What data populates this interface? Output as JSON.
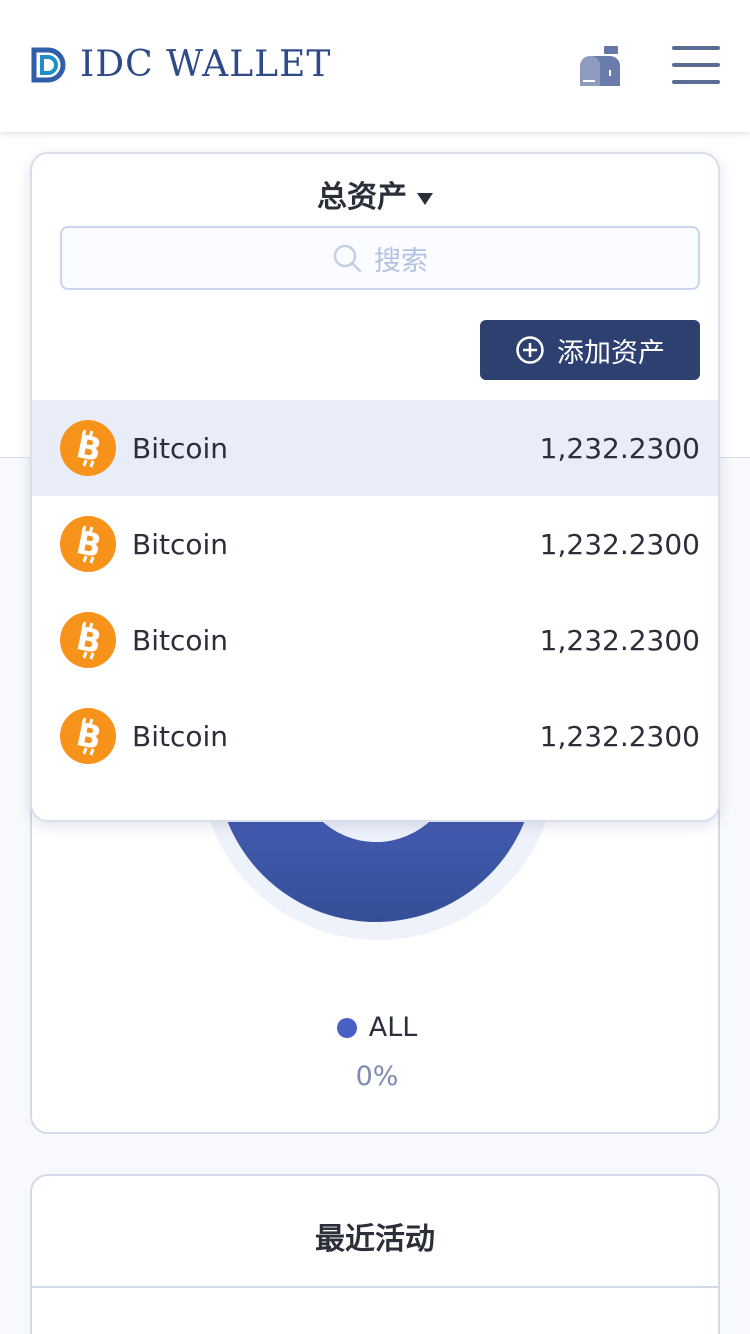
{
  "header": {
    "logo_text": "IDC WALLET",
    "mailbox_icon": "mailbox-icon",
    "menu_icon": "hamburger-menu-icon"
  },
  "dropdown": {
    "title": "总资产",
    "search_placeholder": "搜索",
    "add_button_label": "添加资产",
    "assets": [
      {
        "name": "Bitcoin",
        "amount": "1,232.2300",
        "icon": "bitcoin-icon"
      },
      {
        "name": "Bitcoin",
        "amount": "1,232.2300",
        "icon": "bitcoin-icon"
      },
      {
        "name": "Bitcoin",
        "amount": "1,232.2300",
        "icon": "bitcoin-icon"
      },
      {
        "name": "Bitcoin",
        "amount": "1,232.2300",
        "icon": "bitcoin-icon"
      }
    ]
  },
  "chart": {
    "legend_label": "ALL",
    "legend_percent": "0%"
  },
  "activity": {
    "title": "最近活动"
  },
  "colors": {
    "brand": "#2f4a88",
    "button": "#2e4070",
    "bitcoin": "#f7931a",
    "donut": "#3e55a8",
    "selected_row": "#e9edf8"
  }
}
